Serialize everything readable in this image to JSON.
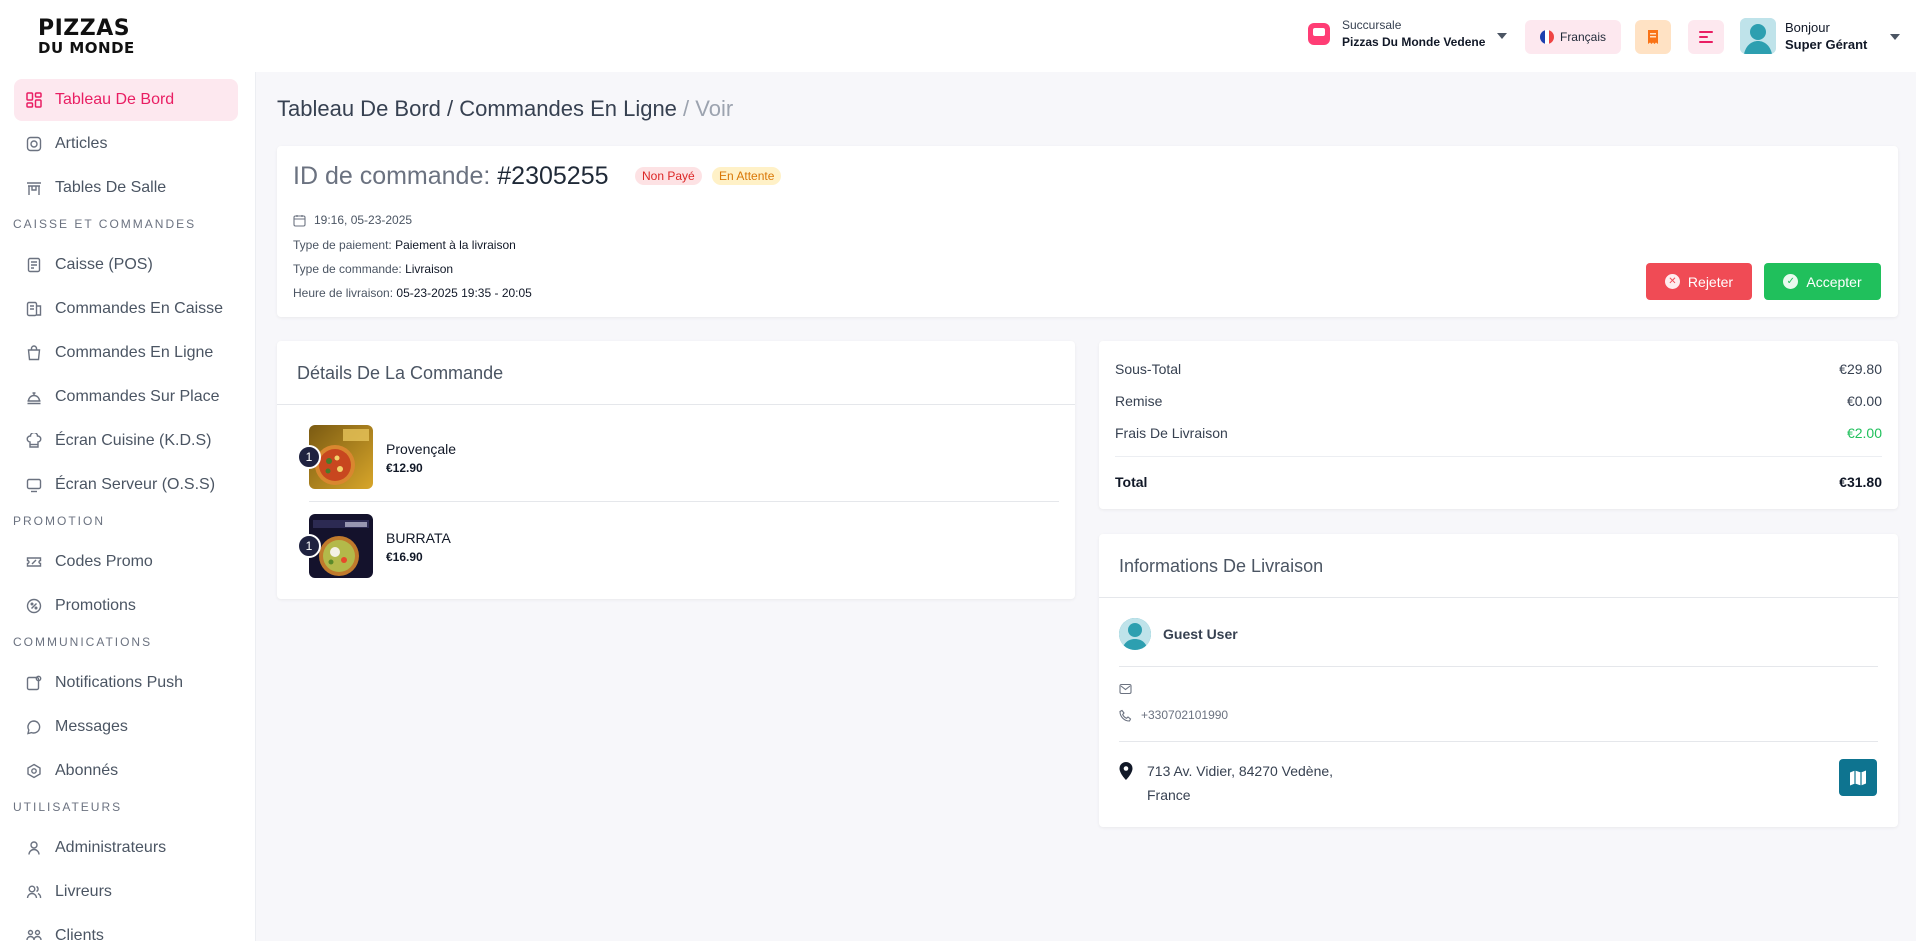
{
  "logo": {
    "line1": "PIZZAS",
    "line2": "DU MONDE"
  },
  "header": {
    "branch_label": "Succursale",
    "branch_name": "Pizzas Du Monde Vedene",
    "language": "Français",
    "greeting": "Bonjour",
    "user_name": "Super Gérant"
  },
  "sidebar": {
    "items_top": [
      {
        "label": "Tableau De Bord",
        "icon": "dashboard-icon",
        "active": true
      },
      {
        "label": "Articles",
        "icon": "articles-icon"
      },
      {
        "label": "Tables De Salle",
        "icon": "table-icon"
      }
    ],
    "sections": [
      {
        "title": "CAISSE ET COMMANDES",
        "items": [
          {
            "label": "Caisse (POS)",
            "icon": "pos-icon"
          },
          {
            "label": "Commandes En Caisse",
            "icon": "cashier-orders-icon"
          },
          {
            "label": "Commandes En Ligne",
            "icon": "online-orders-icon"
          },
          {
            "label": "Commandes Sur Place",
            "icon": "dine-in-icon"
          },
          {
            "label": "Écran Cuisine (K.D.S)",
            "icon": "kitchen-icon"
          },
          {
            "label": "Écran Serveur (O.S.S)",
            "icon": "server-screen-icon"
          }
        ]
      },
      {
        "title": "PROMOTION",
        "items": [
          {
            "label": "Codes Promo",
            "icon": "coupon-icon"
          },
          {
            "label": "Promotions",
            "icon": "promotion-icon"
          }
        ]
      },
      {
        "title": "COMMUNICATIONS",
        "items": [
          {
            "label": "Notifications Push",
            "icon": "notification-icon"
          },
          {
            "label": "Messages",
            "icon": "message-icon"
          },
          {
            "label": "Abonnés",
            "icon": "subscribers-icon"
          }
        ]
      },
      {
        "title": "UTILISATEURS",
        "items": [
          {
            "label": "Administrateurs",
            "icon": "admin-icon"
          },
          {
            "label": "Livreurs",
            "icon": "delivery-men-icon"
          },
          {
            "label": "Clients",
            "icon": "customers-icon"
          }
        ]
      }
    ]
  },
  "breadcrumb": {
    "part1": "Tableau De Bord",
    "sep": " / ",
    "part2": "Commandes En Ligne",
    "current": "Voir"
  },
  "order": {
    "id_label": "ID de commande:",
    "id": "#2305255",
    "payment_badge": "Non Payé",
    "status_badge": "En Attente",
    "datetime": "19:16, 05-23-2025",
    "payment_type_label": "Type de paiement:",
    "payment_type": "Paiement à la livraison",
    "order_type_label": "Type de commande:",
    "order_type": "Livraison",
    "delivery_time_label": "Heure de livraison:",
    "delivery_time": "05-23-2025 19:35 - 20:05",
    "reject_label": "Rejeter",
    "accept_label": "Accepter"
  },
  "details": {
    "title": "Détails De La Commande",
    "items": [
      {
        "qty": "1",
        "name": "Provençale",
        "price": "€12.90"
      },
      {
        "qty": "1",
        "name": "BURRATA",
        "price": "€16.90"
      }
    ]
  },
  "totals": {
    "subtotal_label": "Sous-Total",
    "subtotal": "€29.80",
    "discount_label": "Remise",
    "discount": "€0.00",
    "delivery_fee_label": "Frais De Livraison",
    "delivery_fee": "€2.00",
    "total_label": "Total",
    "total": "€31.80"
  },
  "delivery": {
    "title": "Informations De Livraison",
    "customer": "Guest User",
    "phone": "+330702101990",
    "address_line1": "713 Av. Vidier, 84270 Vedène,",
    "address_line2": "France"
  },
  "colors": {
    "accent": "#e91e63",
    "reject": "#f04b55",
    "accept": "#20c05c",
    "map_button": "#0e7490"
  }
}
